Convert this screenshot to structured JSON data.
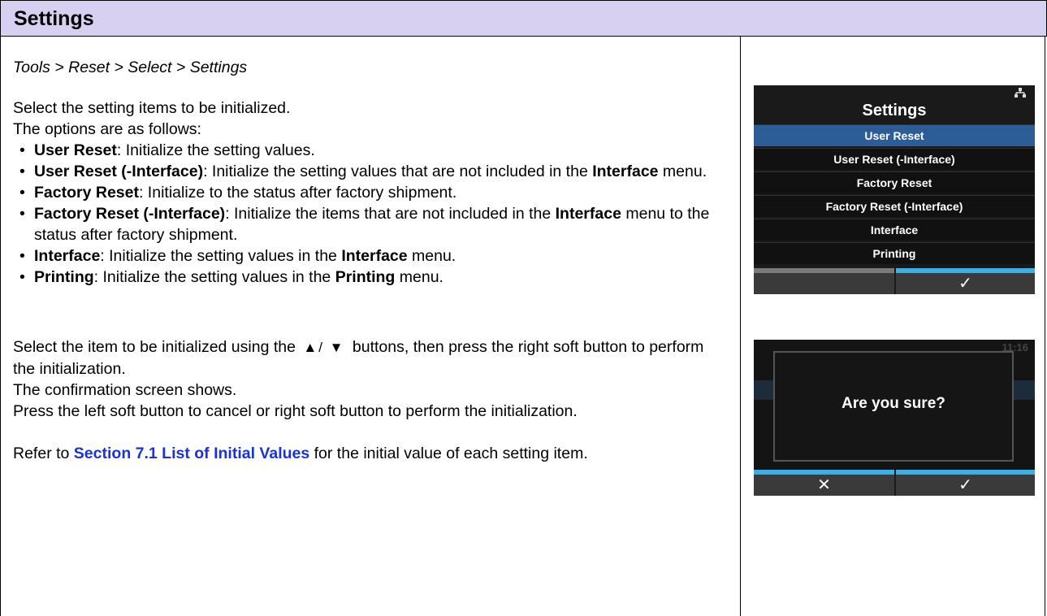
{
  "header": {
    "title": "Settings"
  },
  "breadcrumb": "Tools > Reset > Select > Settings",
  "intro": {
    "line1": "Select the setting items to be initialized.",
    "line2": "The options are as follows:"
  },
  "options": [
    {
      "name": "User Reset",
      "desc_pre": ": Initialize the setting values.",
      "bold2": "",
      "desc_post": ""
    },
    {
      "name": "User Reset (-Interface)",
      "desc_pre": ": Initialize the setting values that are not included in the ",
      "bold2": "Interface",
      "desc_post": " menu."
    },
    {
      "name": "Factory Reset",
      "desc_pre": ": Initialize to the status after factory shipment.",
      "bold2": "",
      "desc_post": ""
    },
    {
      "name": "Factory Reset (-Interface)",
      "desc_pre": ": Initialize the items that are not included in the ",
      "bold2": "Interface",
      "desc_post": " menu to the status after factory shipment."
    },
    {
      "name": "Interface",
      "desc_pre": ": Initialize the setting values in the ",
      "bold2": "Interface",
      "desc_post": " menu."
    },
    {
      "name": "Printing",
      "desc_pre": ": Initialize the setting values in the ",
      "bold2": "Printing",
      "desc_post": " menu."
    }
  ],
  "instructions": {
    "select_pre": "Select the item to be initialized using the",
    "arrows": "▲/ ▼",
    "select_post": "buttons, then press the right soft button to perform the initialization.",
    "confirm": "The confirmation screen shows.",
    "press": "Press the left soft button to cancel or right soft button to perform the initialization."
  },
  "reference": {
    "pre": "Refer to ",
    "link": "Section 7.1 List of Initial Values",
    "post": " for the initial value of each setting item."
  },
  "screen1": {
    "title": "Settings",
    "items": [
      "User Reset",
      "User Reset (-Interface)",
      "Factory Reset",
      "Factory Reset (-Interface)",
      "Interface",
      "Printing"
    ],
    "selected_index": 0,
    "right_button": "✓",
    "network_icon": "network-icon"
  },
  "screen2": {
    "clock": "11:16",
    "message": "Are you sure?",
    "left_button": "✕",
    "right_button": "✓"
  },
  "colors": {
    "header_bg": "#d8d0f0",
    "link": "#1a33d6",
    "highlight": "#3ab0e6",
    "selected_item": "#2d5d96"
  }
}
